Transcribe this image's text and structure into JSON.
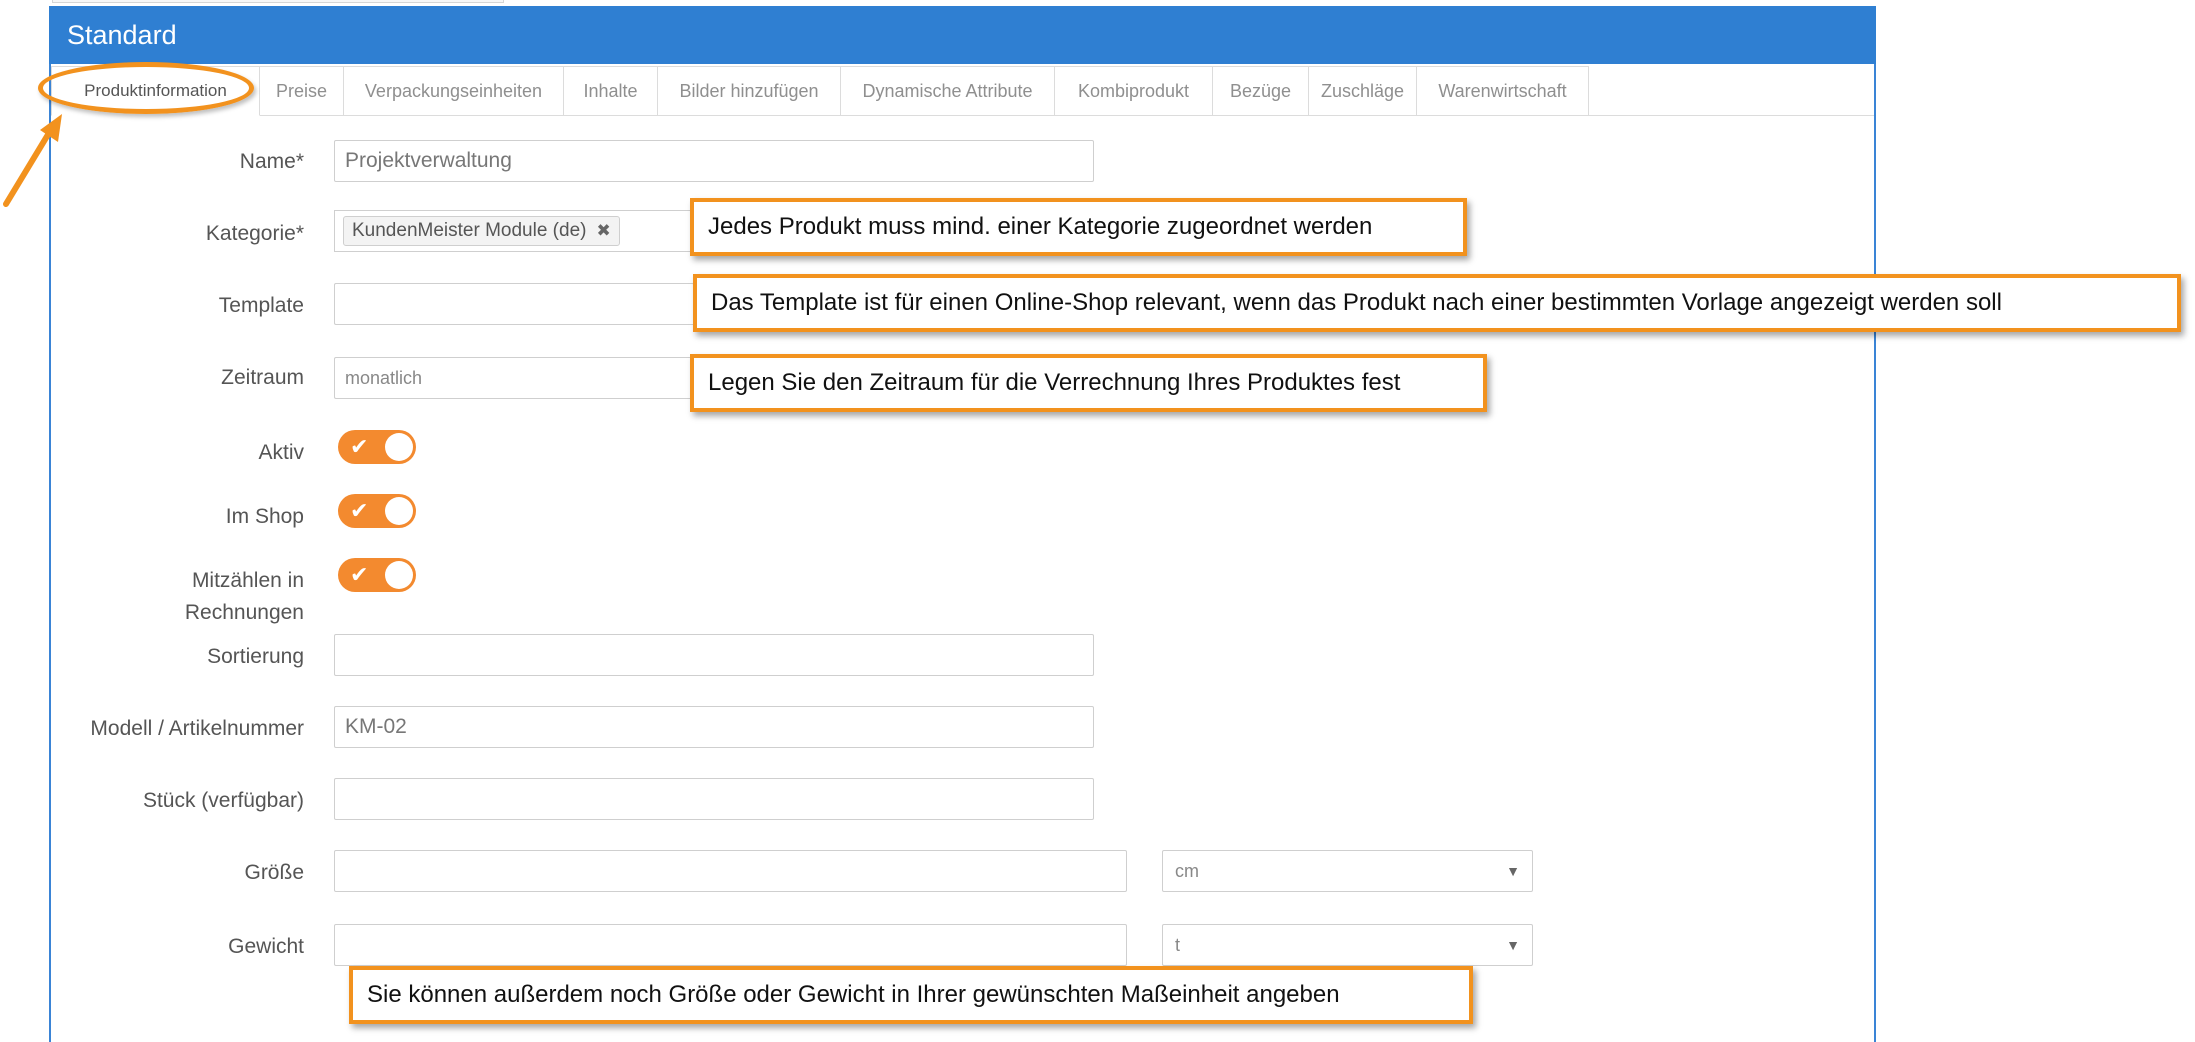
{
  "panel": {
    "title": "Standard"
  },
  "tabs": [
    {
      "label": "Produktinformation",
      "active": true
    },
    {
      "label": "Preise"
    },
    {
      "label": "Verpackungseinheiten"
    },
    {
      "label": "Inhalte"
    },
    {
      "label": "Bilder hinzufügen"
    },
    {
      "label": "Dynamische Attribute"
    },
    {
      "label": "Kombiprodukt"
    },
    {
      "label": "Bezüge"
    },
    {
      "label": "Zuschläge"
    },
    {
      "label": "Warenwirtschaft"
    }
  ],
  "form": {
    "name": {
      "label": "Name*",
      "value": "Projektverwaltung"
    },
    "kategorie": {
      "label": "Kategorie*",
      "chip": "KundenMeister Module (de)",
      "chip_remove": "✖"
    },
    "template": {
      "label": "Template",
      "value": ""
    },
    "zeitraum": {
      "label": "Zeitraum",
      "value": "monatlich"
    },
    "aktiv": {
      "label": "Aktiv",
      "on": true
    },
    "im_shop": {
      "label": "Im Shop",
      "on": true
    },
    "mitzaehlen": {
      "label_line1": "Mitzählen in",
      "label_line2": "Rechnungen",
      "on": true
    },
    "sortierung": {
      "label": "Sortierung",
      "value": ""
    },
    "modell": {
      "label": "Modell / Artikelnummer",
      "value": "KM-02"
    },
    "stueck": {
      "label": "Stück (verfügbar)",
      "value": ""
    },
    "groesse": {
      "label": "Größe",
      "value": "",
      "unit": "cm"
    },
    "gewicht": {
      "label": "Gewicht",
      "value": "",
      "unit": "t"
    }
  },
  "callouts": {
    "kategorie": "Jedes Produkt muss mind. einer Kategorie zugeordnet werden",
    "template": "Das Template ist für einen Online-Shop relevant, wenn das Produkt nach einer bestimmten Vorlage angezeigt werden soll",
    "zeitraum": "Legen Sie den Zeitraum für die Verrechnung Ihres Produktes fest",
    "masseinheit": "Sie können außerdem noch Größe oder Gewicht in Ihrer gewünschten Maßeinheit angeben"
  },
  "colors": {
    "header_blue": "#2f7fd2",
    "accent_orange": "#f2921e",
    "toggle_orange": "#f38a2f"
  }
}
